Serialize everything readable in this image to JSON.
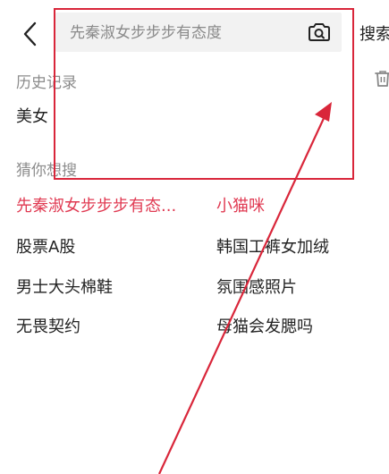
{
  "header": {
    "search_placeholder": "先秦淑女步步步有态度",
    "search_button_label": "搜索"
  },
  "history": {
    "title": "历史记录",
    "items": [
      "美女"
    ]
  },
  "guess": {
    "title": "猜你想搜",
    "items": [
      {
        "label": "先秦淑女步步步有态...",
        "highlight": true
      },
      {
        "label": "小猫咪",
        "highlight": true
      },
      {
        "label": "股票A股",
        "highlight": false
      },
      {
        "label": "韩国工裤女加绒",
        "highlight": false
      },
      {
        "label": "男士大头棉鞋",
        "highlight": false
      },
      {
        "label": "氛围感照片",
        "highlight": false
      },
      {
        "label": "无畏契约",
        "highlight": false
      },
      {
        "label": "母猫会发腮吗",
        "highlight": false
      }
    ]
  },
  "colors": {
    "highlight_text": "#e03a52",
    "annotation": "#d9263a",
    "search_bg": "#f2f2f2"
  },
  "icons": {
    "back": "chevron-left-icon",
    "camera": "camera-search-icon",
    "trash": "trash-icon"
  }
}
